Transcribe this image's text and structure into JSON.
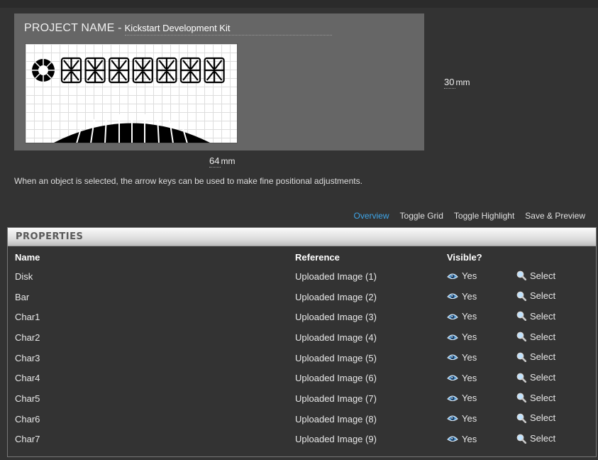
{
  "project": {
    "label": "PROJECT NAME -",
    "name": "Kickstart Development Kit"
  },
  "dimensions": {
    "height_value": "30",
    "height_unit": "mm",
    "width_value": "64",
    "width_unit": "mm"
  },
  "hint": "When an object is selected, the arrow keys can be used to make fine positional adjustments.",
  "nav": {
    "overview": "Overview",
    "toggle_grid": "Toggle Grid",
    "toggle_highlight": "Toggle Highlight",
    "save_preview": "Save & Preview"
  },
  "properties": {
    "title": "PROPERTIES",
    "columns": {
      "name": "Name",
      "reference": "Reference",
      "visible": "Visible?"
    },
    "rows": [
      {
        "name": "Disk",
        "reference": "Uploaded Image (1)",
        "visible": "Yes",
        "action": "Select"
      },
      {
        "name": "Bar",
        "reference": "Uploaded Image (2)",
        "visible": "Yes",
        "action": "Select"
      },
      {
        "name": "Char1",
        "reference": "Uploaded Image (3)",
        "visible": "Yes",
        "action": "Select"
      },
      {
        "name": "Char2",
        "reference": "Uploaded Image (4)",
        "visible": "Yes",
        "action": "Select"
      },
      {
        "name": "Char3",
        "reference": "Uploaded Image (5)",
        "visible": "Yes",
        "action": "Select"
      },
      {
        "name": "Char4",
        "reference": "Uploaded Image (6)",
        "visible": "Yes",
        "action": "Select"
      },
      {
        "name": "Char5",
        "reference": "Uploaded Image (7)",
        "visible": "Yes",
        "action": "Select"
      },
      {
        "name": "Char6",
        "reference": "Uploaded Image (8)",
        "visible": "Yes",
        "action": "Select"
      },
      {
        "name": "Char7",
        "reference": "Uploaded Image (9)",
        "visible": "Yes",
        "action": "Select"
      }
    ]
  },
  "colors": {
    "accent": "#3ea5e8",
    "panel_bg": "#666666",
    "page_bg": "#333333"
  },
  "icons": {
    "visible": "eye-icon",
    "select": "magnifier-icon"
  }
}
